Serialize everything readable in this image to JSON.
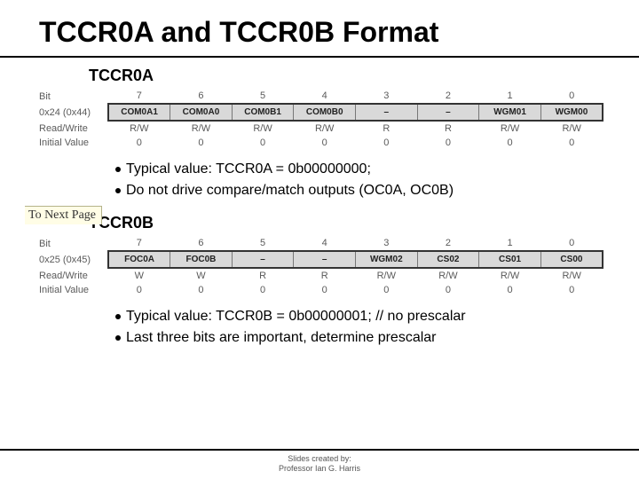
{
  "title": "TCCR0A and TCCR0B Format",
  "nextpage_label": "To Next Page",
  "tccr0a": {
    "label": "TCCR0A",
    "rows": {
      "bit": {
        "label": "Bit",
        "cells": [
          "7",
          "6",
          "5",
          "4",
          "3",
          "2",
          "1",
          "0"
        ]
      },
      "addr": {
        "label": "0x24 (0x44)",
        "cells": [
          "COM0A1",
          "COM0A0",
          "COM0B1",
          "COM0B0",
          "–",
          "–",
          "WGM01",
          "WGM00"
        ]
      },
      "rw": {
        "label": "Read/Write",
        "cells": [
          "R/W",
          "R/W",
          "R/W",
          "R/W",
          "R",
          "R",
          "R/W",
          "R/W"
        ]
      },
      "init": {
        "label": "Initial Value",
        "cells": [
          "0",
          "0",
          "0",
          "0",
          "0",
          "0",
          "0",
          "0"
        ]
      }
    },
    "bullets": [
      "Typical value: TCCR0A = 0b00000000;",
      "Do not drive compare/match outputs (OC0A, OC0B)"
    ]
  },
  "tccr0b": {
    "label": "TCCR0B",
    "rows": {
      "bit": {
        "label": "Bit",
        "cells": [
          "7",
          "6",
          "5",
          "4",
          "3",
          "2",
          "1",
          "0"
        ]
      },
      "addr": {
        "label": "0x25 (0x45)",
        "cells": [
          "FOC0A",
          "FOC0B",
          "–",
          "–",
          "WGM02",
          "CS02",
          "CS01",
          "CS00"
        ]
      },
      "rw": {
        "label": "Read/Write",
        "cells": [
          "W",
          "W",
          "R",
          "R",
          "R/W",
          "R/W",
          "R/W",
          "R/W"
        ]
      },
      "init": {
        "label": "Initial Value",
        "cells": [
          "0",
          "0",
          "0",
          "0",
          "0",
          "0",
          "0",
          "0"
        ]
      }
    },
    "bullets": [
      "Typical value: TCCR0B = 0b00000001; // no prescalar",
      "Last three bits are important, determine prescalar"
    ]
  },
  "footer": {
    "line1": "Slides created by:",
    "line2": "Professor Ian G. Harris"
  }
}
